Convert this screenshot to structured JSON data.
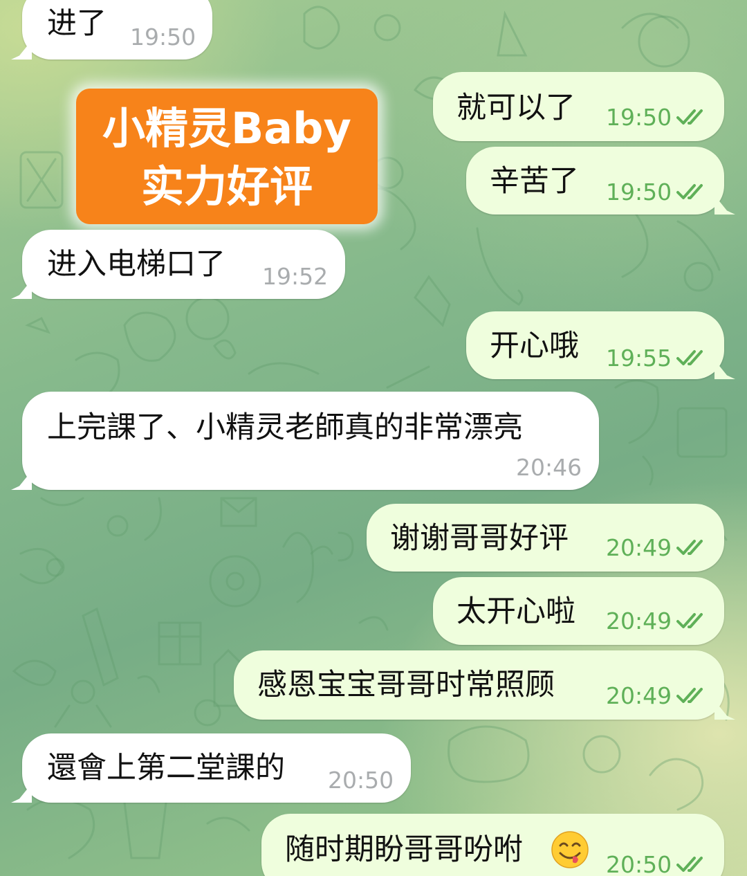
{
  "colors": {
    "incoming_bubble": "#ffffff",
    "outgoing_bubble": "#effedd",
    "incoming_time": "#a9acae",
    "outgoing_time_and_checks": "#5fb058",
    "promo_badge": "#f7831a"
  },
  "promo": {
    "line1": "小精灵Baby",
    "line2": "实力好评"
  },
  "messages": [
    {
      "direction": "in",
      "text": "进了",
      "time": "19:50"
    },
    {
      "direction": "out",
      "text": "就可以了",
      "time": "19:50",
      "status_icon": "double-check-icon"
    },
    {
      "direction": "out",
      "text": "辛苦了",
      "time": "19:50",
      "status_icon": "double-check-icon"
    },
    {
      "direction": "in",
      "text": "进入电梯口了",
      "time": "19:52"
    },
    {
      "direction": "out",
      "text": "开心哦",
      "time": "19:55",
      "status_icon": "double-check-icon"
    },
    {
      "direction": "in",
      "text": "上完課了、小精灵老師真的非常漂亮",
      "time": "20:46"
    },
    {
      "direction": "out",
      "text": "谢谢哥哥好评",
      "time": "20:49",
      "status_icon": "double-check-icon"
    },
    {
      "direction": "out",
      "text": "太开心啦",
      "time": "20:49",
      "status_icon": "double-check-icon"
    },
    {
      "direction": "out",
      "text": "感恩宝宝哥哥时常照顾",
      "time": "20:49",
      "status_icon": "double-check-icon"
    },
    {
      "direction": "in",
      "text": "還會上第二堂課的",
      "time": "20:50"
    },
    {
      "direction": "out",
      "text": "随时期盼哥哥吩咐",
      "emoji": "yum-face-emoji",
      "time": "20:50",
      "status_icon": "double-check-icon"
    }
  ]
}
